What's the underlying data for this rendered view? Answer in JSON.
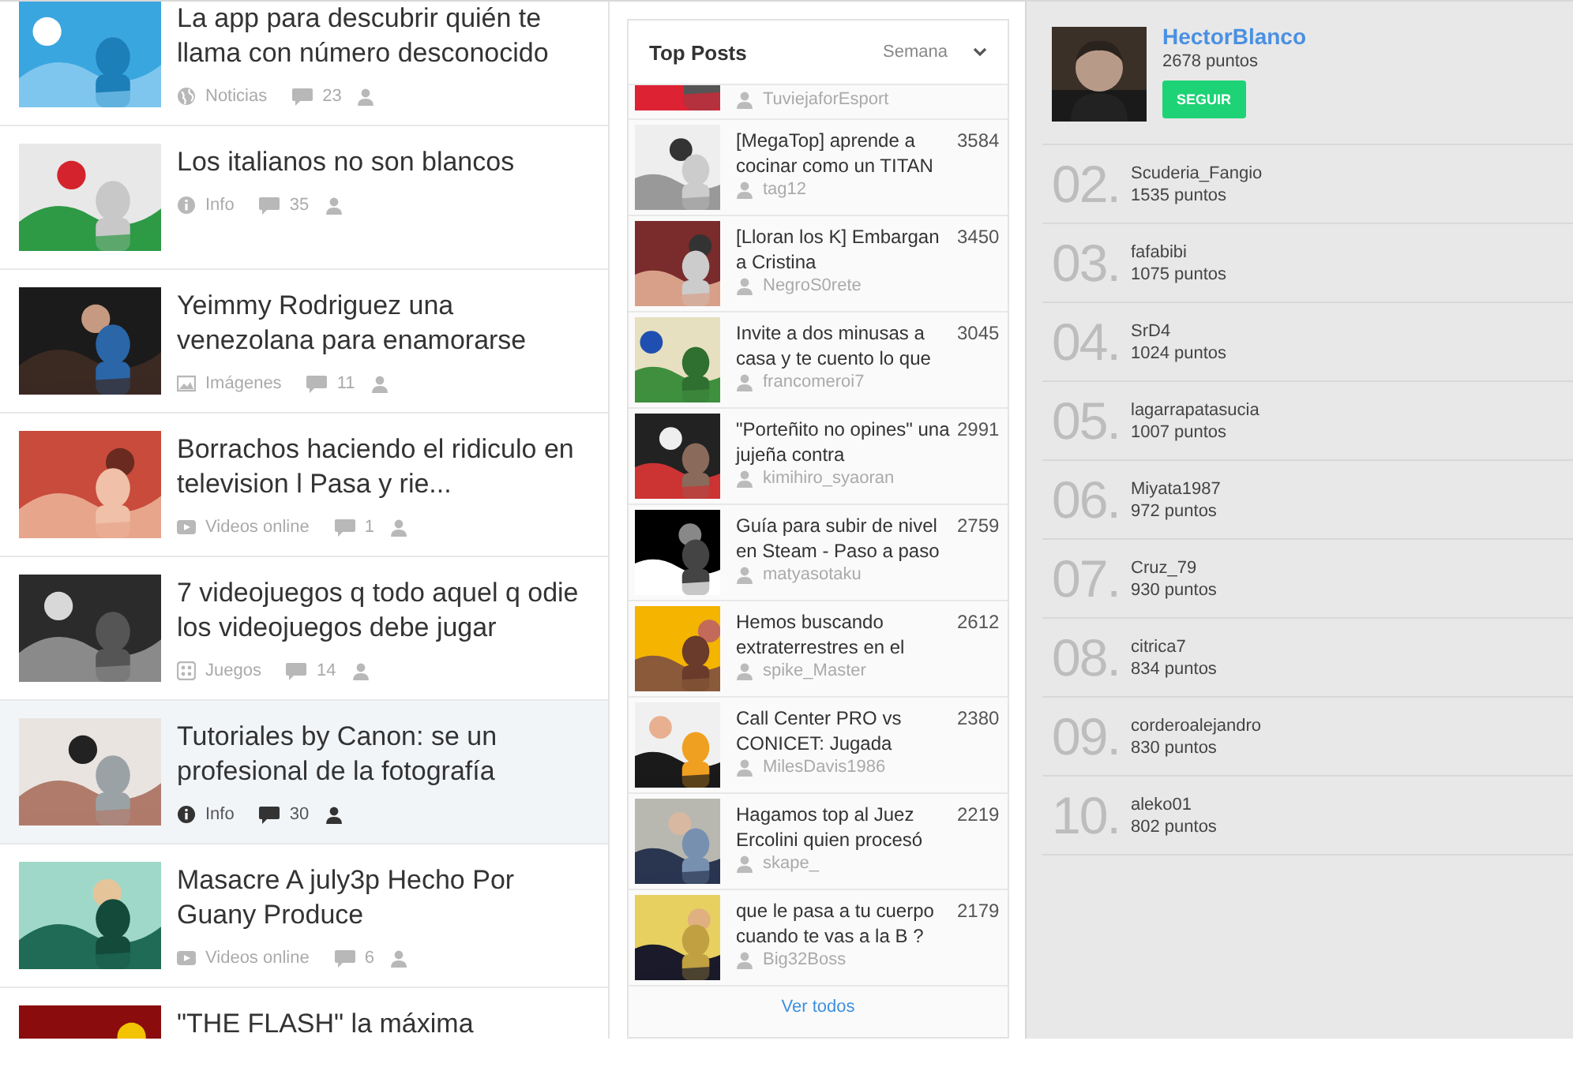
{
  "feed": [
    {
      "title": "La app para descubrir quién te llama con número desconocido",
      "kind": "news",
      "category": "Noticias",
      "comments": "23",
      "highlighted": false
    },
    {
      "title": "Los italianos no son blancos",
      "kind": "info",
      "category": "Info",
      "comments": "35",
      "highlighted": false
    },
    {
      "title": "Yeimmy Rodriguez una venezolana para enamorarse",
      "kind": "images",
      "category": "Imágenes",
      "comments": "11",
      "highlighted": false
    },
    {
      "title": "Borrachos haciendo el ridiculo en television l Pasa y rie...",
      "kind": "video",
      "category": "Videos online",
      "comments": "1",
      "highlighted": false
    },
    {
      "title": "7 videojuegos q todo aquel q odie los videojuegos debe jugar",
      "kind": "games",
      "category": "Juegos",
      "comments": "14",
      "highlighted": false
    },
    {
      "title": "Tutoriales by Canon: se un profesional de la fotografía",
      "kind": "info",
      "category": "Info",
      "comments": "30",
      "highlighted": true
    },
    {
      "title": "Masacre A july3p Hecho Por Guany Produce",
      "kind": "video",
      "category": "Videos online",
      "comments": "6",
      "highlighted": false
    },
    {
      "title": "\"THE FLASH\" la máxima"
    }
  ],
  "top_posts": {
    "title": "Top Posts",
    "period": "Semana",
    "items": [
      {
        "author": "TuviejaforEsport"
      },
      {
        "title": "[MegaTop] aprende a cocinar como un TITAN",
        "score": "3584",
        "author": "tag12"
      },
      {
        "title": "[Lloran los K] Embargan a Cristina",
        "score": "3450",
        "author": "NegroS0rete"
      },
      {
        "title": "Invite a dos minusas a casa y te cuento lo que",
        "score": "3045",
        "author": "francomeroi7"
      },
      {
        "title": "\"Porteñito no opines\" una jujeña contra",
        "score": "2991",
        "author": "kimihiro_syaoran"
      },
      {
        "title": "Guía para subir de nivel en Steam - Paso a paso",
        "score": "2759",
        "author": "matyasotaku"
      },
      {
        "title": "Hemos buscando extraterrestres en el",
        "score": "2612",
        "author": "spike_Master"
      },
      {
        "title": "Call Center PRO vs CONICET: Jugada",
        "score": "2380",
        "author": "MilesDavis1986"
      },
      {
        "title": "Hagamos top al Juez Ercolini quien procesó",
        "score": "2219",
        "author": "skape_"
      },
      {
        "title": "que le pasa a tu cuerpo cuando te vas a la B ?",
        "score": "2179",
        "author": "Big32Boss"
      }
    ],
    "footer_link": "Ver todos"
  },
  "ranking": {
    "leader": {
      "name": "HectorBlanco",
      "points": "2678 puntos",
      "button": "SEGUIR"
    },
    "rows": [
      {
        "rank": "02.",
        "name": "Scuderia_Fangio",
        "points": "1535 puntos"
      },
      {
        "rank": "03.",
        "name": "fafabibi",
        "points": "1075 puntos"
      },
      {
        "rank": "04.",
        "name": "SrD4",
        "points": "1024 puntos"
      },
      {
        "rank": "05.",
        "name": "lagarrapatasucia",
        "points": "1007 puntos"
      },
      {
        "rank": "06.",
        "name": "Miyata1987",
        "points": "972 puntos"
      },
      {
        "rank": "07.",
        "name": "Cruz_79",
        "points": "930 puntos"
      },
      {
        "rank": "08.",
        "name": "citrica7",
        "points": "834 puntos"
      },
      {
        "rank": "09.",
        "name": "corderoalejandro",
        "points": "830 puntos"
      },
      {
        "rank": "10.",
        "name": "aleko01",
        "points": "802 puntos"
      }
    ]
  }
}
